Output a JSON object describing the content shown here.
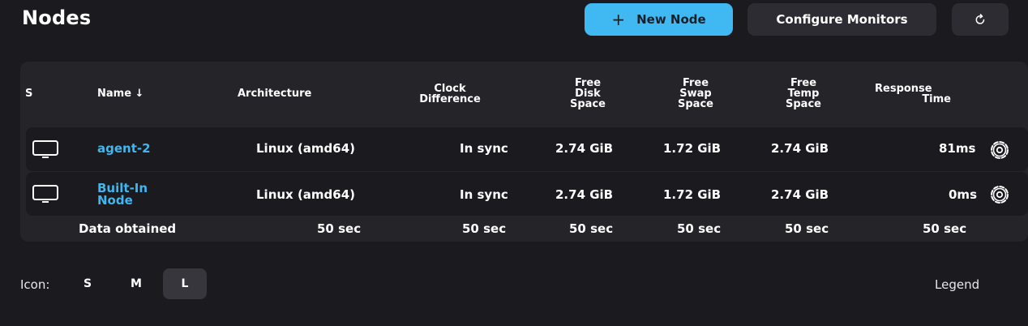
{
  "header": {
    "title": "Nodes",
    "new_node_label": "New Node",
    "configure_label": "Configure Monitors",
    "refresh_icon": "refresh-icon"
  },
  "table": {
    "columns": {
      "status": "S",
      "name": "Name ↓",
      "architecture": "Architecture",
      "clock_1": "Clock",
      "clock_2": "Difference",
      "disk_1": "Free",
      "disk_2": "Disk",
      "disk_3": "Space",
      "swap_1": "Free",
      "swap_2": "Swap",
      "swap_3": "Space",
      "temp_1": "Free",
      "temp_2": "Temp",
      "temp_3": "Space",
      "resp_1": "Response",
      "resp_2": "Time"
    },
    "rows": [
      {
        "name": "agent-2",
        "architecture": "Linux (amd64)",
        "clock": "In sync",
        "disk": "2.74 GiB",
        "swap": "1.72 GiB",
        "temp": "2.74 GiB",
        "response": "81ms",
        "icon": "computer-icon"
      },
      {
        "name_line1": "Built-In",
        "name_line2": "Node",
        "architecture": "Linux (amd64)",
        "clock": "In sync",
        "disk": "2.74 GiB",
        "swap": "1.72 GiB",
        "temp": "2.74 GiB",
        "response": "0ms",
        "icon": "computer-icon"
      }
    ],
    "footer": {
      "label": "Data obtained",
      "architecture": "50 sec",
      "clock": "50 sec",
      "disk": "50 sec",
      "swap": "50 sec",
      "temp": "50 sec",
      "response": "50 sec"
    }
  },
  "bottom": {
    "icon_label": "Icon:",
    "sizes": [
      "S",
      "M",
      "L"
    ],
    "selected_size": "L",
    "legend_label": "Legend"
  },
  "colors": {
    "background": "#1b1b1f",
    "panel": "#242429",
    "accent": "#40b8f2",
    "link": "#41b6ee"
  }
}
